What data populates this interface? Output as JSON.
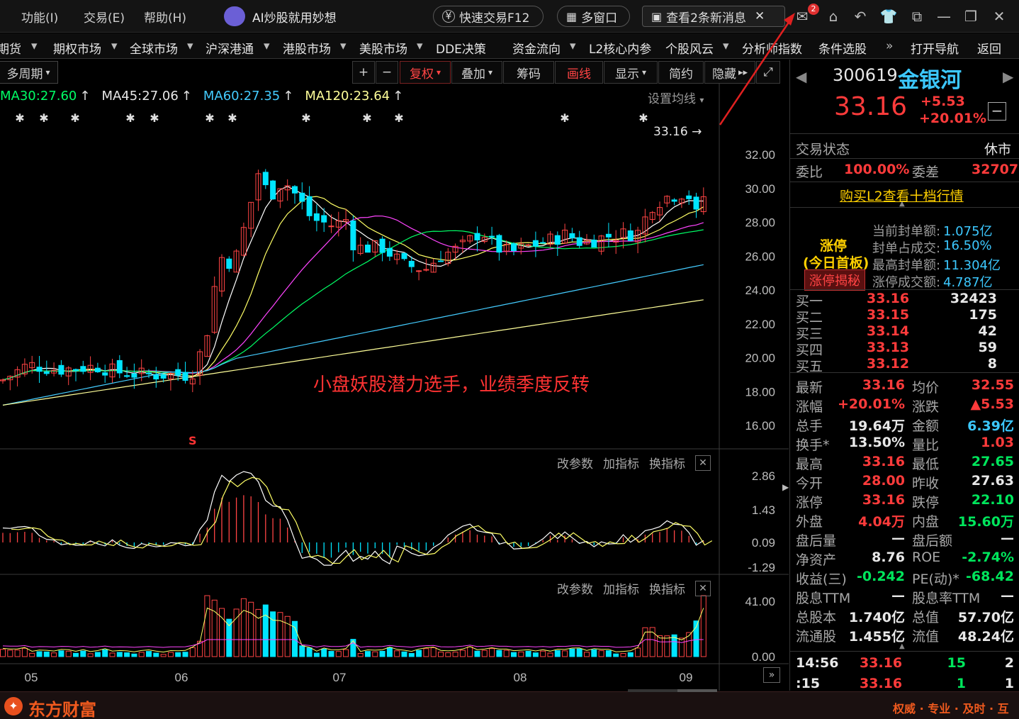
{
  "titlebar": {
    "menus": [
      "功能(I)",
      "交易(E)",
      "帮助(H)"
    ],
    "ai_label": "AI炒股就用妙想",
    "quick_trade": "快速交易F12",
    "multi_window": "多窗口",
    "messages": "查看2条新消息",
    "mail_badge": "2"
  },
  "navbar": {
    "items": [
      "期货",
      "期权市场",
      "全球市场",
      "沪深港通",
      "港股市场",
      "美股市场",
      "DDE决策",
      "资金流向",
      "L2核心内参",
      "个股风云",
      "分析师指数",
      "条件选股",
      "打开导航",
      "返回"
    ]
  },
  "chart_toolbar": {
    "period": "多周期",
    "plus": "+",
    "minus": "−",
    "fuquan": "复权",
    "diejia": "叠加",
    "chouma": "筹码",
    "huaxian": "画线",
    "xianshi": "显示",
    "jianyue": "简约",
    "yincang": "隐藏",
    "settings_ma": "设置均线"
  },
  "ma_legend": {
    "ma30": "MA30:27.60",
    "ma45": "MA45:27.06",
    "ma60": "MA60:27.35",
    "ma120": "MA120:23.64"
  },
  "chart_annotation": "小盘妖股潜力选手，业绩季度反转",
  "price_marker": "33.16",
  "s_marker": "S",
  "subpanel_buttons": [
    "改参数",
    "加指标",
    "换指标"
  ],
  "chart_data": {
    "type": "candlestick",
    "x_ticks": [
      "05",
      "06",
      "07",
      "08",
      "09"
    ],
    "price_axis": [
      "32.00",
      "30.00",
      "28.00",
      "26.00",
      "24.00",
      "22.00",
      "20.00",
      "18.00",
      "16.00"
    ],
    "macd_axis": [
      "2.86",
      "1.43",
      "0.09",
      "-1.29"
    ],
    "vol_axis": [
      "41.00",
      "0.00"
    ],
    "last_price": 33.16,
    "series_colors": {
      "up": "#ff4444",
      "down": "#00e5ff",
      "ma5": "#ffffff",
      "ma10": "#ffff66",
      "ma20": "#ff44ff",
      "ma30": "#00ff66",
      "ma60": "#44ccff",
      "ma120": "#ffff99"
    }
  },
  "quote": {
    "code": "300619",
    "name": "金银河",
    "price": "33.16",
    "change": "+5.53",
    "change_pct": "+20.01%",
    "status_label": "交易状态",
    "status_value": "休市",
    "weibi_label": "委比",
    "weibi_value": "100.00%",
    "weicha_label": "委差",
    "weicha_value": "32707",
    "l2_link": "购买L2查看十档行情",
    "limit_title": "涨停",
    "limit_sub": "(今日首板)",
    "limit_button": "涨停揭秘",
    "limit_stats": [
      {
        "label": "当前封单额:",
        "value": "1.075亿"
      },
      {
        "label": "封单占成交:",
        "value": "16.50%"
      },
      {
        "label": "最高封单额:",
        "value": "11.304亿"
      },
      {
        "label": "涨停成交额:",
        "value": "4.787亿"
      }
    ],
    "bids": [
      {
        "label": "买一",
        "price": "33.16",
        "vol": "32423"
      },
      {
        "label": "买二",
        "price": "33.15",
        "vol": "175"
      },
      {
        "label": "买三",
        "price": "33.14",
        "vol": "42"
      },
      {
        "label": "买四",
        "price": "33.13",
        "vol": "59"
      },
      {
        "label": "买五",
        "price": "33.12",
        "vol": "8"
      }
    ],
    "stats": [
      {
        "l1": "最新",
        "v1": "33.16",
        "l2": "均价",
        "v2": "32.55"
      },
      {
        "l1": "涨幅",
        "v1": "+20.01%",
        "l2": "涨跌",
        "v2": "▲5.53"
      },
      {
        "l1": "总手",
        "v1": "19.64万",
        "l2": "金额",
        "v2": "6.39亿"
      },
      {
        "l1": "换手*",
        "v1": "13.50%",
        "l2": "量比",
        "v2": "1.03"
      },
      {
        "l1": "最高",
        "v1": "33.16",
        "l2": "最低",
        "v2": "27.65"
      },
      {
        "l1": "今开",
        "v1": "28.00",
        "l2": "昨收",
        "v2": "27.63"
      },
      {
        "l1": "涨停",
        "v1": "33.16",
        "l2": "跌停",
        "v2": "22.10"
      },
      {
        "l1": "外盘",
        "v1": "4.04万",
        "l2": "内盘",
        "v2": "15.60万"
      },
      {
        "l1": "盘后量",
        "v1": "—",
        "l2": "盘后额",
        "v2": "—"
      },
      {
        "l1": "净资产",
        "v1": "8.76",
        "l2": "ROE",
        "v2": "-2.74%"
      },
      {
        "l1": "收益(三)",
        "v1": "-0.242",
        "l2": "PE(动)*",
        "v2": "-68.42"
      },
      {
        "l1": "股息TTM",
        "v1": "—",
        "l2": "股息率TTM",
        "v2": "—"
      },
      {
        "l1": "总股本",
        "v1": "1.740亿",
        "l2": "总值",
        "v2": "57.70亿"
      },
      {
        "l1": "流通股",
        "v1": "1.455亿",
        "l2": "流值",
        "v2": "48.24亿"
      }
    ],
    "ticks": [
      {
        "time": "14:56",
        "price": "33.16",
        "vol": "15",
        "n": "2"
      },
      {
        "time": ":15",
        "price": "33.16",
        "vol": "1",
        "n": "1"
      }
    ]
  },
  "bottom": {
    "brand": "东方财富",
    "slogan": "权威 · 专业 · 及时 · 互动"
  }
}
